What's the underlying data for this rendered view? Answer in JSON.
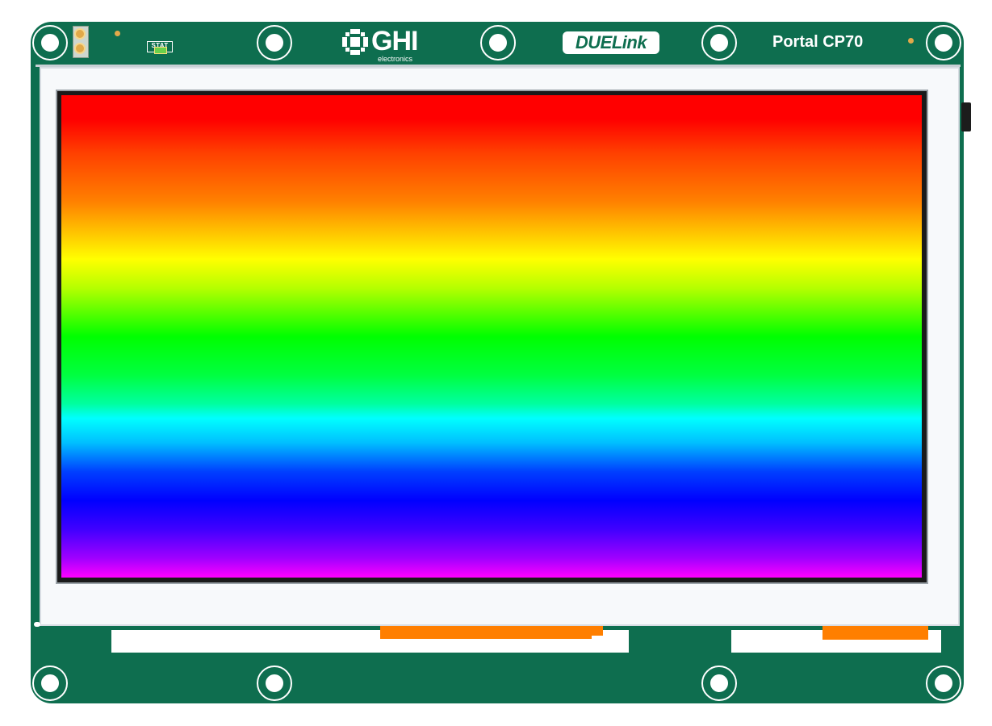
{
  "board": {
    "brand": "GHI",
    "brand_sub": "electronics",
    "product_logo": "DUELink",
    "model_label": "Portal CP70",
    "status_label": "STAT"
  },
  "display": {
    "content": "rainbow-gradient",
    "colors": [
      "#ff0000",
      "#ff8000",
      "#ffff00",
      "#00ff00",
      "#00ffff",
      "#0000ff",
      "#ff00ff"
    ]
  },
  "colors": {
    "pcb": "#0e6e4f",
    "bezel": "#f7f9fb",
    "connector": "#ff7f00",
    "accent_pad": "#e2a94a"
  }
}
